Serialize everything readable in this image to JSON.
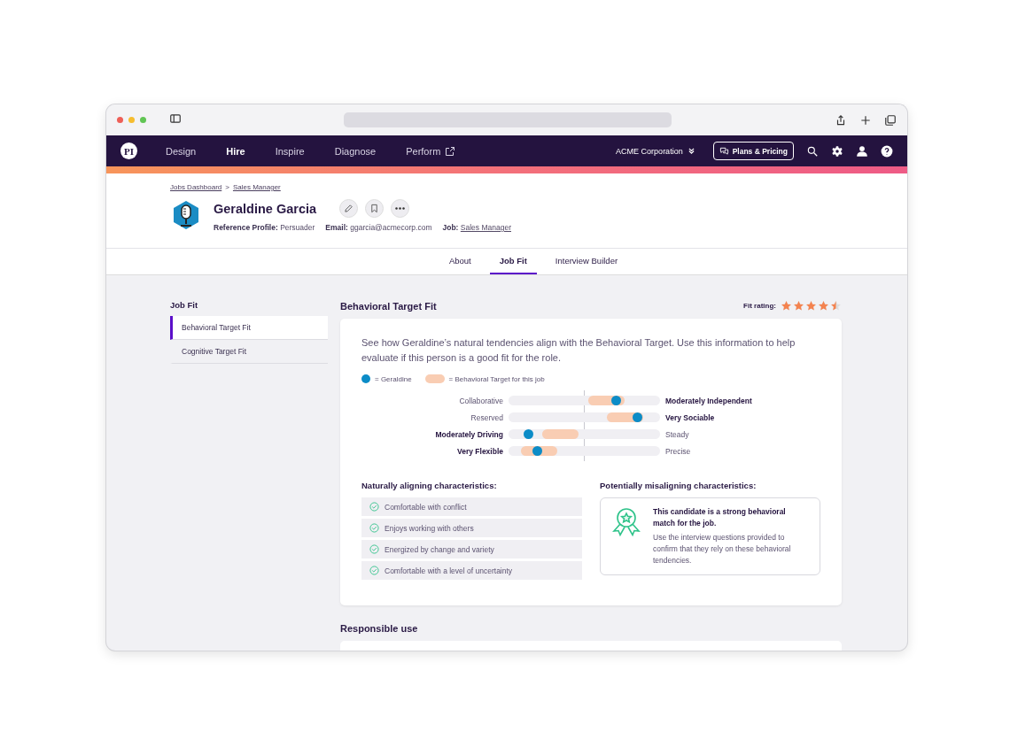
{
  "nav": {
    "logo": "PI",
    "items": [
      {
        "label": "Design",
        "selected": false,
        "external": false
      },
      {
        "label": "Hire",
        "selected": true,
        "external": false
      },
      {
        "label": "Inspire",
        "selected": false,
        "external": false
      },
      {
        "label": "Diagnose",
        "selected": false,
        "external": false
      },
      {
        "label": "Perform",
        "selected": false,
        "external": true
      }
    ],
    "company": "ACME Corporation",
    "plans_button": "Plans & Pricing"
  },
  "breadcrumb": [
    "Jobs Dashboard",
    "Sales Manager"
  ],
  "breadcrumb_separator": ">",
  "profile": {
    "name": "Geraldine Garcia",
    "fields": [
      {
        "label": "Reference Profile:",
        "value": "Persuader",
        "link": false
      },
      {
        "label": "Email:",
        "value": "ggarcia@acmecorp.com",
        "link": false
      },
      {
        "label": "Job:",
        "value": "Sales Manager",
        "link": true
      }
    ]
  },
  "tabs": [
    {
      "label": "About",
      "selected": false
    },
    {
      "label": "Job Fit",
      "selected": true
    },
    {
      "label": "Interview Builder",
      "selected": false
    }
  ],
  "sidebar": {
    "title": "Job Fit",
    "items": [
      {
        "label": "Behavioral Target Fit",
        "selected": true
      },
      {
        "label": "Cognitive Target Fit",
        "selected": false
      }
    ]
  },
  "section": {
    "title": "Behavioral Target Fit",
    "fit_rating_label": "Fit rating:",
    "stars": 4.5,
    "intro": "See how Geraldine’s natural tendencies align with the Behavioral Target. Use this information to help evaluate if this person is a good fit for the role.",
    "legend": [
      "= Geraldine",
      "= Behavioral Target for this job"
    ],
    "factors": [
      {
        "left": {
          "text": "Collaborative",
          "bold": false
        },
        "right": {
          "text": "Moderately Independent",
          "bold": true
        },
        "level": 0.71,
        "target": {
          "level": 0.645
        }
      },
      {
        "left": {
          "text": "Reserved",
          "bold": false
        },
        "right": {
          "text": "Very Sociable",
          "bold": true
        },
        "level": 0.85,
        "target": {
          "level": 0.77
        }
      },
      {
        "left": {
          "text": "Moderately Driving",
          "bold": true
        },
        "right": {
          "text": "Steady",
          "bold": false
        },
        "level": 0.13,
        "target": {
          "level": 0.34
        }
      },
      {
        "left": {
          "text": "Very Flexible",
          "bold": true
        },
        "right": {
          "text": "Precise",
          "bold": false
        },
        "level": 0.19,
        "target": {
          "level": 0.2
        }
      }
    ],
    "aligning_title": "Naturally aligning characteristics:",
    "aligning": [
      "Comfortable with conflict",
      "Enjoys working with others",
      "Energized by change and variety",
      "Comfortable with a level of uncertainty"
    ],
    "misaligning_title": "Potentially misaligning characteristics:",
    "misaligning_heading": "This candidate is a strong behavioral match for the job.",
    "misaligning_text": "Use the interview questions provided to confirm that they rely on these behavioral tendencies."
  },
  "responsible_title": "Responsible use"
}
